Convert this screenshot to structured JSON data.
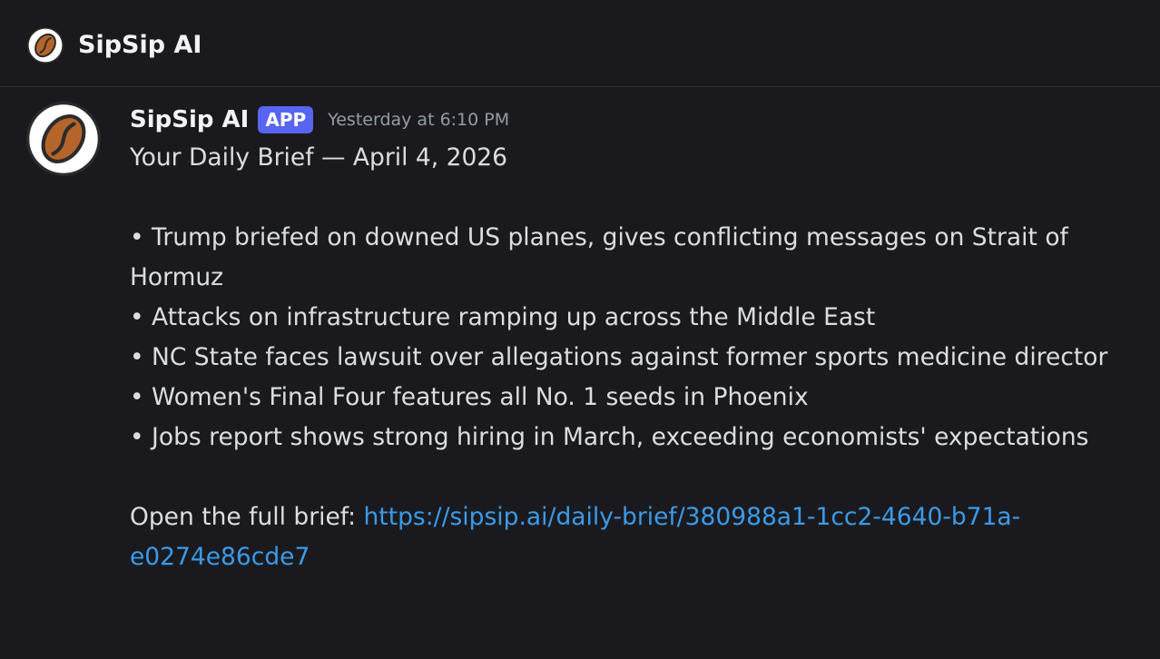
{
  "header": {
    "title": "SipSip AI",
    "avatar_icon": "coffee-bean-icon"
  },
  "message": {
    "author": "SipSip AI",
    "badge": "APP",
    "timestamp": "Yesterday at 6:10 PM",
    "avatar_icon": "coffee-bean-icon",
    "title_line": "Your Daily Brief — April 4, 2026",
    "bullets": [
      "• Trump briefed on downed US planes, gives conflicting messages on Strait of Hormuz",
      "• Attacks on infrastructure ramping up across the Middle East",
      "• NC State faces lawsuit over allegations against former sports medicine director",
      "• Women's Final Four features all No. 1 seeds in Phoenix",
      "• Jobs report shows strong hiring in March, exceeding economists' expectations"
    ],
    "link_prefix": "Open the full brief: ",
    "link_url": "https://sipsip.ai/daily-brief/380988a1-1cc2-4640-b71a-e0274e86cde7"
  },
  "colors": {
    "background": "#1a1a1e",
    "badge": "#5865f2",
    "link": "#3b9ae8",
    "bean": "#b5652a",
    "text": "#dbdee1",
    "muted": "#949ba4"
  }
}
